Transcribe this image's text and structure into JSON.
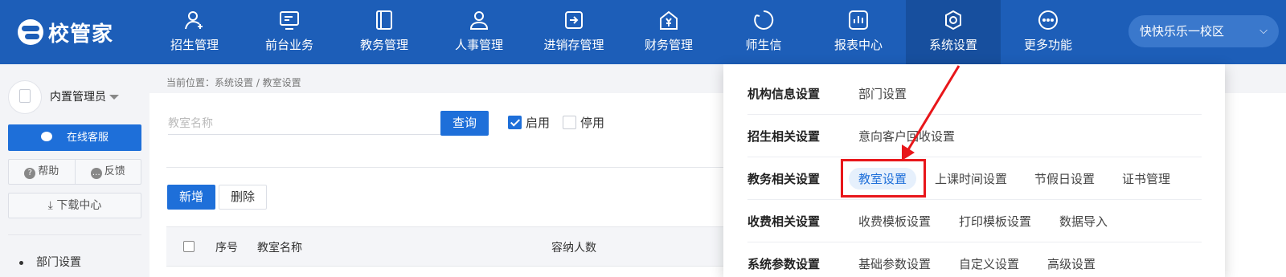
{
  "app": {
    "logo_text": "校管家"
  },
  "nav": {
    "items": [
      {
        "label": "招生管理",
        "icon": "user-add-icon"
      },
      {
        "label": "前台业务",
        "icon": "monitor-icon"
      },
      {
        "label": "教务管理",
        "icon": "book-icon"
      },
      {
        "label": "人事管理",
        "icon": "person-icon"
      },
      {
        "label": "进销存管理",
        "icon": "enter-box-icon"
      },
      {
        "label": "财务管理",
        "icon": "yen-house-icon"
      },
      {
        "label": "师生信",
        "icon": "chat-circle-icon"
      },
      {
        "label": "报表中心",
        "icon": "bar-chart-icon"
      },
      {
        "label": "系统设置",
        "icon": "gear-icon",
        "active": true
      },
      {
        "label": "更多功能",
        "icon": "more-dots-icon"
      }
    ],
    "campus": "快快乐乐一校区"
  },
  "sidebar": {
    "username": "内置管理员",
    "service_button": "在线客服",
    "help": "帮助",
    "feedback": "反馈",
    "download": "下载中心",
    "items": [
      {
        "label": "部门设置"
      }
    ]
  },
  "breadcrumb": "当前位置：系统设置 / 教室设置",
  "filter": {
    "search_placeholder": "教室名称",
    "query_button": "查询",
    "enabled_label": "启用",
    "enabled_checked": true,
    "disabled_label": "停用",
    "disabled_checked": false
  },
  "toolbar": {
    "add": "新增",
    "delete": "删除"
  },
  "table": {
    "columns": [
      "序号",
      "教室名称",
      "容纳人数"
    ]
  },
  "dropdown": {
    "rows": [
      {
        "category": "机构信息设置",
        "links": [
          "部门设置"
        ]
      },
      {
        "category": "招生相关设置",
        "links": [
          "意向客户回收设置"
        ]
      },
      {
        "category": "教务相关设置",
        "links": [
          "教室设置",
          "上课时间设置",
          "节假日设置",
          "证书管理"
        ],
        "highlighted": "教室设置"
      },
      {
        "category": "收费相关设置",
        "links": [
          "收费模板设置",
          "打印模板设置",
          "数据导入"
        ]
      },
      {
        "category": "系统参数设置",
        "links": [
          "基础参数设置",
          "自定义设置",
          "高级设置"
        ]
      }
    ]
  },
  "colors": {
    "brand": "#1d5eb8",
    "primary": "#1e6fd9",
    "annotation": "#e8161a"
  }
}
